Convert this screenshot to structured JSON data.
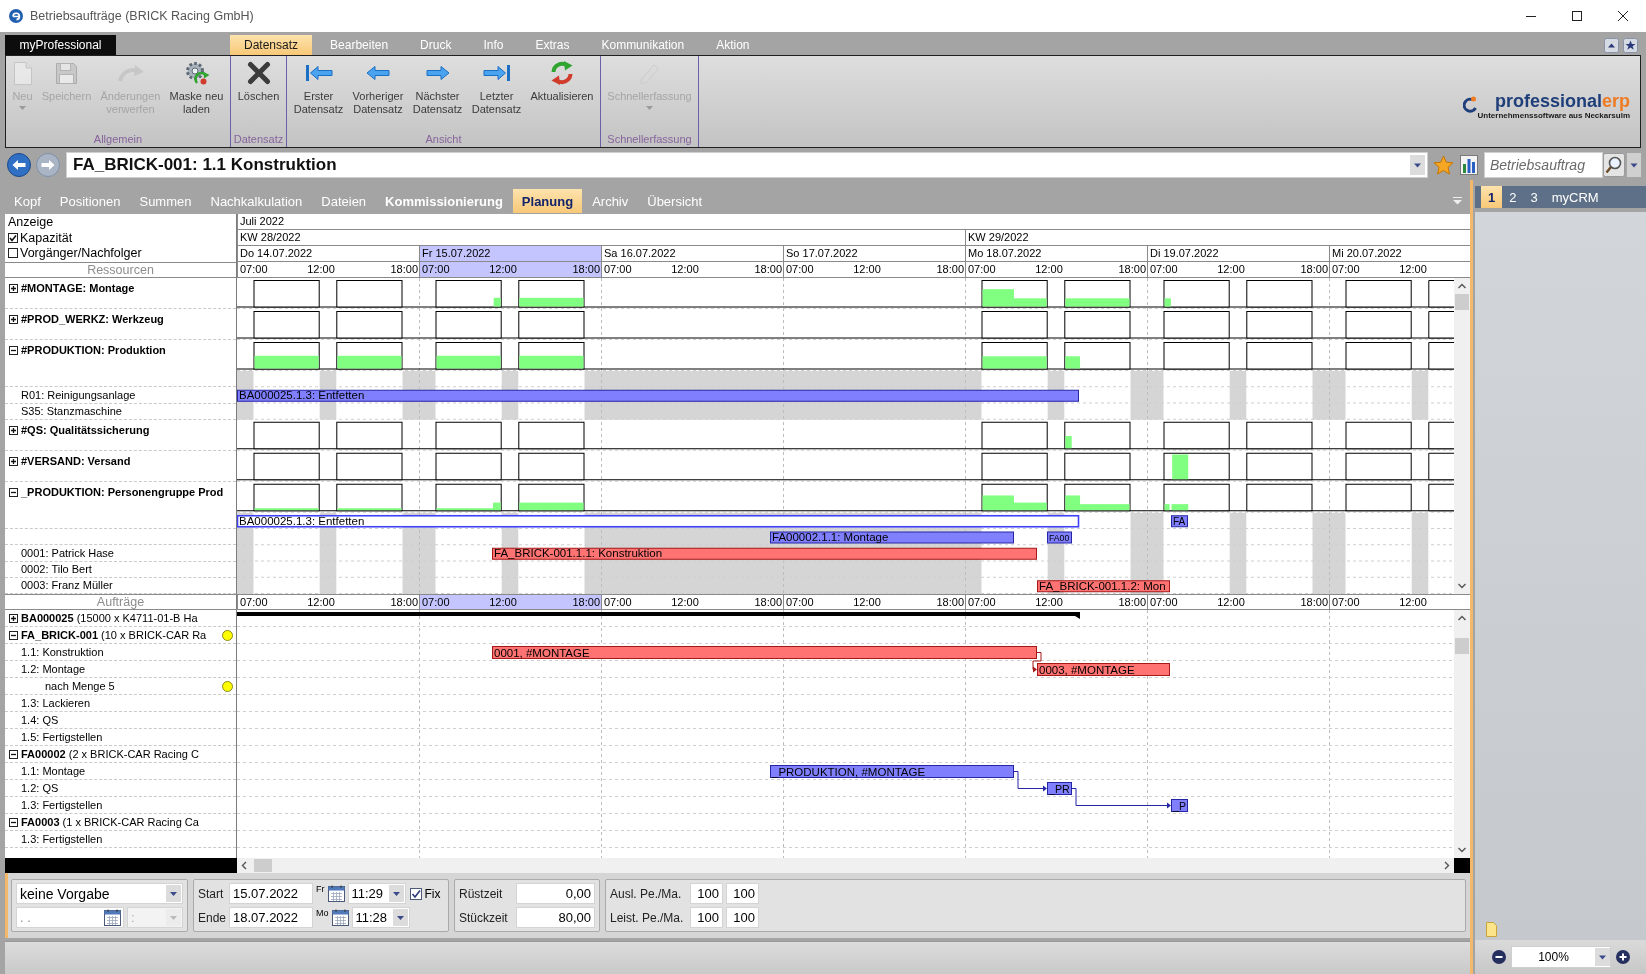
{
  "window": {
    "title": "Betriebsaufträge (BRICK Racing GmbH)"
  },
  "ribbon": {
    "app_tab": "myProfessional",
    "tabs": [
      {
        "label": "Datensatz",
        "selected": true
      },
      {
        "label": "Bearbeiten",
        "selected": false
      },
      {
        "label": "Druck",
        "selected": false
      },
      {
        "label": "Info",
        "selected": false
      },
      {
        "label": "Extras",
        "selected": false
      },
      {
        "label": "Kommunikation",
        "selected": false
      },
      {
        "label": "Aktion",
        "selected": false
      }
    ],
    "groups": [
      {
        "label": "Allgemein",
        "buttons": [
          {
            "label": "Neu",
            "disabled": true,
            "dropdown": true
          },
          {
            "label": "Speichern",
            "disabled": true,
            "dropdown": false
          },
          {
            "label": "Änderungen verwerfen",
            "disabled": true,
            "dropdown": false
          },
          {
            "label": "Maske neu laden",
            "disabled": false,
            "dropdown": false
          }
        ]
      },
      {
        "label": "Datensatz",
        "buttons": [
          {
            "label": "Löschen",
            "disabled": false,
            "dropdown": false
          }
        ]
      },
      {
        "label": "Ansicht",
        "buttons": [
          {
            "label": "Erster Datensatz",
            "disabled": false,
            "dropdown": false
          },
          {
            "label": "Vorheriger Datensatz",
            "disabled": false,
            "dropdown": false
          },
          {
            "label": "Nächster Datensatz",
            "disabled": false,
            "dropdown": false
          },
          {
            "label": "Letzter Datensatz",
            "disabled": false,
            "dropdown": false
          },
          {
            "label": "Aktualisieren",
            "disabled": false,
            "dropdown": false
          }
        ]
      },
      {
        "label": "Schnellerfassung",
        "buttons": [
          {
            "label": "Schnellerfassung",
            "disabled": true,
            "dropdown": true
          }
        ]
      }
    ],
    "logo": {
      "name": "professional",
      "suffix": "erp",
      "tagline": "Unternehmenssoftware aus Neckarsulm"
    }
  },
  "address_bar": {
    "back_disabled": false,
    "forward_disabled": true,
    "record": "FA_BRICK-001: 1.1 Konstruktion",
    "search": {
      "placeholder": "Betriebsauftrag"
    }
  },
  "nav_tabs": [
    {
      "label": "Kopf",
      "selected": false,
      "emphasized": false
    },
    {
      "label": "Positionen",
      "selected": false,
      "emphasized": false
    },
    {
      "label": "Summen",
      "selected": false,
      "emphasized": false
    },
    {
      "label": "Nachkalkulation",
      "selected": false,
      "emphasized": false
    },
    {
      "label": "Dateien",
      "selected": false,
      "emphasized": false
    },
    {
      "label": "Kommissionierung",
      "selected": false,
      "emphasized": true
    },
    {
      "label": "Planung",
      "selected": true,
      "emphasized": false
    },
    {
      "label": "Archiv",
      "selected": false,
      "emphasized": false
    },
    {
      "label": "Übersicht",
      "selected": false,
      "emphasized": false
    }
  ],
  "side_tabs": [
    {
      "label": "1",
      "selected": true
    },
    {
      "label": "2",
      "selected": false
    },
    {
      "label": "3",
      "selected": false
    },
    {
      "label": "myCRM",
      "selected": false
    }
  ],
  "planning": {
    "display": {
      "title": "Anzeige",
      "options": [
        {
          "label": "Kapazität",
          "checked": true
        },
        {
          "label": "Vorgänger/Nachfolger",
          "checked": false
        }
      ]
    },
    "timeline": {
      "month": "Juli 2022",
      "weeks": [
        "KW 28/2022",
        "KW 29/2022"
      ],
      "days": [
        {
          "label": "Do 14.07.2022",
          "selected": false
        },
        {
          "label": "Fr 15.07.2022",
          "selected": true
        },
        {
          "label": "Sa 16.07.2022",
          "selected": false
        },
        {
          "label": "So 17.07.2022",
          "selected": false
        },
        {
          "label": "Mo 18.07.2022",
          "selected": false
        },
        {
          "label": "Di 19.07.2022",
          "selected": false
        },
        {
          "label": "Mi 20.07.2022",
          "selected": false
        }
      ]
    },
    "resources": {
      "title": "Ressourcen",
      "hours": [
        [
          "07:00",
          "12:00",
          "18:00"
        ],
        [
          "07:00",
          "12:00",
          "18:00"
        ],
        [
          "07:00",
          "12:00",
          "18:00"
        ],
        [
          "07:00",
          "12:00",
          "18:00"
        ],
        [
          "07:00",
          "12:00",
          "18:00"
        ],
        [
          "07:00",
          "12:00",
          "18:00"
        ],
        [
          "07:00",
          "12:00"
        ]
      ],
      "groups": [
        {
          "label": "#MONTAGE: Montage",
          "expanded": false
        },
        {
          "label": "#PROD_WERKZ: Werkzeug",
          "expanded": false
        },
        {
          "label": "#PRODUKTION: Produktion",
          "expanded": true,
          "children": [
            {
              "label": "R01: Reinigungsanlage",
              "bars": [
                {
                  "label": "BA000025.1.3: Entfetten",
                  "outlined": false,
                  "color": "#8080ff"
                }
              ]
            },
            {
              "label": "S35: Stanzmaschine"
            }
          ]
        },
        {
          "label": "#QS: Qualitätssicherung",
          "expanded": false
        },
        {
          "label": "#VERSAND: Versand",
          "expanded": false
        },
        {
          "label": "_PRODUKTION: Personengruppe Prod",
          "expanded": true,
          "lanes": [
            {
              "bars": [
                {
                  "label": "BA000025.1.3: Entfetten",
                  "outlined": true,
                  "color": "#4040ff"
                },
                {
                  "label": "FA",
                  "outlined": false,
                  "color": "#8080ff"
                }
              ]
            },
            {
              "bars": [
                {
                  "label": "FA00002.1.1: Montage",
                  "outlined": false,
                  "color": "#8080ff"
                },
                {
                  "label": "FA00",
                  "outlined": false,
                  "color": "#8080ff"
                }
              ]
            }
          ],
          "children": [
            {
              "label": "0001: Patrick Hase",
              "bars": [
                {
                  "label": "FA_BRICK-001.1.1: Konstruktion",
                  "outlined": false,
                  "color": "#ff7373"
                }
              ]
            },
            {
              "label": "0002: Tilo Bert"
            },
            {
              "label": "0003: Franz Müller",
              "bars": [
                {
                  "label": "FA_BRICK-001.1.2: Mon",
                  "outlined": false,
                  "color": "#ff7373"
                }
              ]
            }
          ]
        }
      ]
    },
    "orders": {
      "title": "Aufträge",
      "hours": [
        [
          "07:00",
          "12:00",
          "18:00"
        ],
        [
          "07:00",
          "12:00",
          "18:00"
        ],
        [
          "07:00",
          "12:00",
          "18:00"
        ],
        [
          "07:00",
          "12:00",
          "18:00"
        ],
        [
          "07:00",
          "12:00",
          "18:00"
        ],
        [
          "07:00",
          "12:00",
          "18:00"
        ],
        [
          "07:00",
          "12:00"
        ]
      ],
      "rows": [
        {
          "label": "**BA000025** (15000 x K4711-01-B Ha",
          "expanded": false
        },
        {
          "label": "**FA_BRICK-001** (10 x BRICK-CAR Ra",
          "expanded": true,
          "color": "#ffff00",
          "children": [
            {
              "label": "1.1: Konstruktion",
              "bars": [
                {
                  "label": "0001, #MONTAGE",
                  "color": "#ff7373"
                }
              ]
            },
            {
              "label": "1.2: Montage",
              "bars": [
                {
                  "label": "0003, #MONTAGE",
                  "color": "#ff7373"
                }
              ],
              "children": [
                {
                  "label": "nach Menge 5",
                  "color": "#ffff00"
                }
              ]
            },
            {
              "label": "1.3: Lackieren"
            },
            {
              "label": "1.4: QS"
            },
            {
              "label": "1.5: Fertigstellen"
            }
          ]
        },
        {
          "label": "**FA00002** (2 x BRICK-CAR Racing C",
          "expanded": true,
          "children": [
            {
              "label": "1.1: Montage",
              "bars": [
                {
                  "label": "_PRODUKTION, #MONTAGE",
                  "color": "#8080ff"
                }
              ]
            },
            {
              "label": "1.2: QS",
              "bars": [
                {
                  "label": "_PR",
                  "color": "#8080ff"
                }
              ]
            },
            {
              "label": "1.3: Fertigstellen",
              "bars": [
                {
                  "label": "_P",
                  "color": "#8080ff"
                }
              ]
            }
          ]
        },
        {
          "label": "**FA0003** (1 x BRICK-CAR Racing Ca",
          "expanded": true,
          "children": [
            {
              "label": "1.3: Fertigstellen"
            }
          ]
        }
      ]
    }
  },
  "detail_form": {
    "preset": "keine Vorgabe",
    "preset_date": ". .",
    "preset_time": ":",
    "preset_time_disabled": true,
    "schedule": [
      {
        "label": "Start",
        "date": "15.07.2022",
        "weekday": "Fr",
        "time": "11:29"
      },
      {
        "label": "Ende",
        "date": "18.07.2022",
        "weekday": "Mo",
        "time": "11:28"
      }
    ],
    "fix": {
      "label": "Fix",
      "checked": true
    },
    "times": [
      {
        "label": "Rüstzeit",
        "value": "0,00"
      },
      {
        "label": "Stückzeit",
        "value": "80,00"
      }
    ],
    "capacities": [
      {
        "label": "Ausl. Pe./Ma.",
        "values": [
          "100",
          "100"
        ]
      },
      {
        "label": "Leist. Pe./Ma.",
        "values": [
          "100",
          "100"
        ]
      }
    ]
  },
  "zoom": {
    "value": "100%"
  }
}
